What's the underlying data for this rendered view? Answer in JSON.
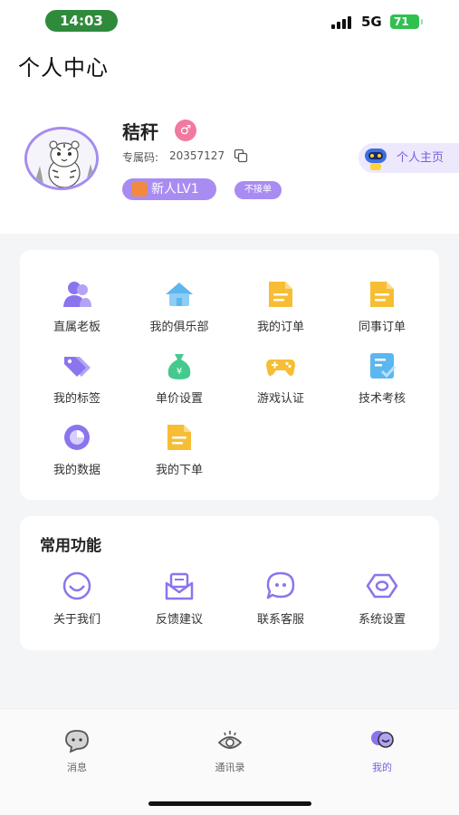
{
  "status_bar": {
    "time": "14:03",
    "network": "5G",
    "battery": "71"
  },
  "header": {
    "title": "个人中心"
  },
  "profile": {
    "name": "秸秆",
    "gender_symbol": "♂",
    "code_label": "专属码:",
    "code_value": "20357127",
    "level": "新人LV1",
    "order_status": "不接单",
    "homepage_label": "个人主页"
  },
  "menu": {
    "items": [
      {
        "label": "直属老板",
        "icon": "person-group-icon"
      },
      {
        "label": "我的俱乐部",
        "icon": "house-icon"
      },
      {
        "label": "我的订单",
        "icon": "document-icon"
      },
      {
        "label": "同事订单",
        "icon": "document-icon"
      },
      {
        "label": "我的标签",
        "icon": "tag-icon"
      },
      {
        "label": "单价设置",
        "icon": "money-bag-icon"
      },
      {
        "label": "游戏认证",
        "icon": "gamepad-icon"
      },
      {
        "label": "技术考核",
        "icon": "checklist-icon"
      },
      {
        "label": "我的数据",
        "icon": "pie-chart-icon"
      },
      {
        "label": "我的下单",
        "icon": "document-icon"
      }
    ]
  },
  "common": {
    "title": "常用功能",
    "items": [
      {
        "label": "关于我们",
        "icon": "smile-icon"
      },
      {
        "label": "反馈建议",
        "icon": "mail-icon"
      },
      {
        "label": "联系客服",
        "icon": "chat-bubble-icon"
      },
      {
        "label": "系统设置",
        "icon": "hexagon-settings-icon"
      }
    ]
  },
  "tabbar": {
    "tabs": [
      {
        "label": "消息",
        "icon": "message-icon"
      },
      {
        "label": "通讯录",
        "icon": "eye-icon"
      },
      {
        "label": "我的",
        "icon": "profile-icon"
      }
    ],
    "active": 2
  },
  "colors": {
    "accent": "#7a5ee0",
    "accent_light": "#a98cf2",
    "yellow": "#f7be35",
    "blue": "#5cb6ef",
    "green": "#46c98d"
  }
}
